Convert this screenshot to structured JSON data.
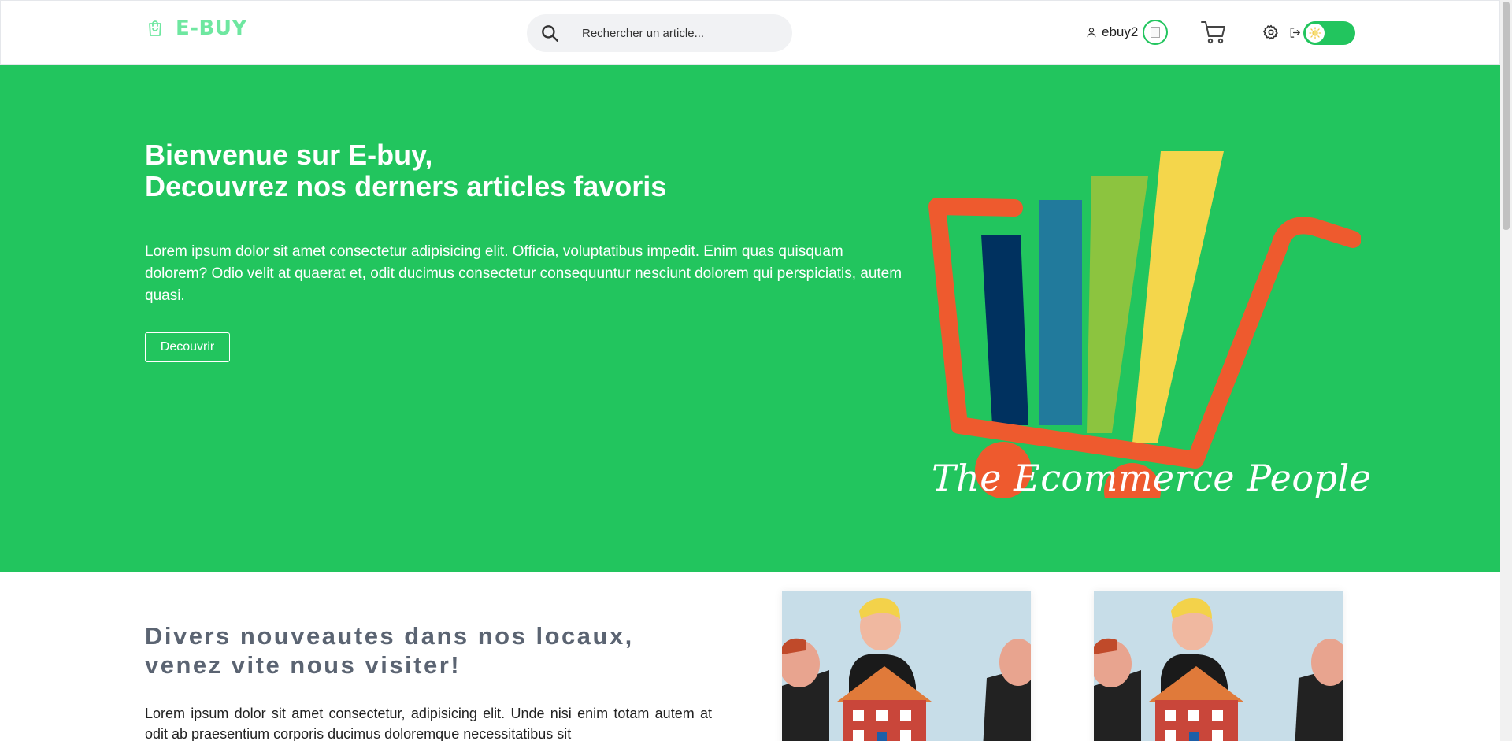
{
  "navbar": {
    "brand_name": "E-BUY",
    "brand_color": "#6ee7a0",
    "search_placeholder": "Rechercher un article...",
    "username": "ebuy2",
    "icons": {
      "brand": "shopping-bag-icon",
      "search": "search-icon",
      "user": "user-icon",
      "cart": "cart-icon",
      "settings": "gear-icon",
      "logout": "logout-icon",
      "theme": "sun-icon"
    },
    "theme_toggle_on": true
  },
  "hero": {
    "title_line1": "Bienvenue sur E-buy,",
    "title_line2": "Decouvrez nos derners articles favoris",
    "text": "Lorem ipsum dolor sit amet consectetur adipisicing elit. Officia, voluptatibus impedit. Enim quas quisquam dolorem? Odio velit at quaerat et, odit ducimus consectetur consequuntur nesciunt dolorem qui perspiciatis, autem quasi.",
    "button_label": "Decouvrir",
    "logo_tagline": "The Ecommerce  People",
    "background_color": "#22c55e"
  },
  "section": {
    "title_line1": "Divers nouveautes dans nos locaux,",
    "title_line2": "venez vite nous visiter!",
    "text": "Lorem ipsum dolor sit amet consectetur, adipisicing elit. Unde nisi enim totam autem at odit ab praesentium corporis ducimus doloremque necessitatibus sit"
  }
}
